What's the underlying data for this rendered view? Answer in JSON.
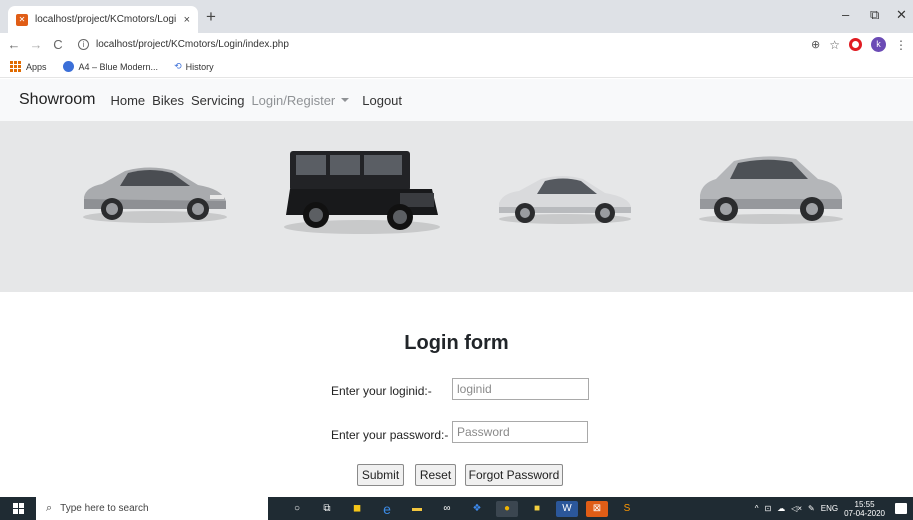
{
  "browser": {
    "tab_title": "localhost/project/KCmotors/Logi",
    "tab_close": "×",
    "new_tab": "+",
    "url": "localhost/project/KCmotors/Login/index.php",
    "window_controls": {
      "minimize": "–",
      "restore": "⧉",
      "close": "✕"
    },
    "profile_initial": "k",
    "bookmarks": [
      {
        "label": "Apps",
        "icon": "apps-grid-icon"
      },
      {
        "label": "A4 – Blue Modern...",
        "icon": "site-icon"
      },
      {
        "label": "History",
        "icon": "history-icon"
      }
    ]
  },
  "site": {
    "brand": "Showroom",
    "nav": [
      {
        "label": "Home"
      },
      {
        "label": "Bikes"
      },
      {
        "label": "Servicing"
      },
      {
        "label": "Login/Register"
      },
      {
        "label": "Logout"
      }
    ]
  },
  "login": {
    "title": "Login form",
    "loginid_label": "Enter your loginid:-",
    "loginid_placeholder": "loginid",
    "loginid_value": "",
    "password_label": "Enter your password:-",
    "password_placeholder": "Password",
    "password_value": "",
    "buttons": {
      "submit": "Submit",
      "reset": "Reset",
      "forgot": "Forgot Password"
    }
  },
  "taskbar": {
    "search_placeholder": "Type here to search",
    "language": "ENG",
    "time": "15:55",
    "date": "07-04-2020"
  },
  "colors": {
    "navbar_bg": "#f8f9fa",
    "banner_bg": "#e6e7e8",
    "taskbar_bg": "#1f2b33"
  }
}
